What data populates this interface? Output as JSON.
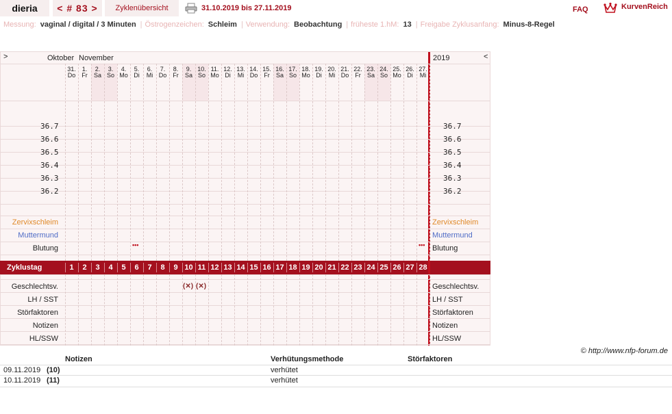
{
  "header": {
    "user": "dieria",
    "cycle": "< # 83 >",
    "overview_tab": "Zyklenübersicht",
    "date_range": "31.10.2019 bis 27.11.2019",
    "faq": "FAQ",
    "logo_text": "KurvenReich"
  },
  "settings": [
    {
      "label": "Messung:",
      "value": "vaginal / digital / 3 Minuten"
    },
    {
      "label": "Östrogenzeichen:",
      "value": "Schleim"
    },
    {
      "label": "Verwendung:",
      "value": "Beobachtung"
    },
    {
      "label": "früheste 1.hM:",
      "value": "13"
    },
    {
      "label": "Freigabe Zyklusanfang:",
      "value": "Minus-8-Regel"
    }
  ],
  "chart": {
    "nav_prev": ">",
    "nav_next": "<",
    "month1": "Oktober",
    "month2": "November",
    "year": "2019",
    "days": [
      {
        "d": "31.",
        "w": "Do",
        "we": false
      },
      {
        "d": "1.",
        "w": "Fr",
        "we": false
      },
      {
        "d": "2.",
        "w": "Sa",
        "we": true
      },
      {
        "d": "3.",
        "w": "So",
        "we": true
      },
      {
        "d": "4.",
        "w": "Mo",
        "we": false
      },
      {
        "d": "5.",
        "w": "Di",
        "we": false
      },
      {
        "d": "6.",
        "w": "Mi",
        "we": false
      },
      {
        "d": "7.",
        "w": "Do",
        "we": false
      },
      {
        "d": "8.",
        "w": "Fr",
        "we": false
      },
      {
        "d": "9.",
        "w": "Sa",
        "we": true
      },
      {
        "d": "10.",
        "w": "So",
        "we": true
      },
      {
        "d": "11.",
        "w": "Mo",
        "we": false
      },
      {
        "d": "12.",
        "w": "Di",
        "we": false
      },
      {
        "d": "13.",
        "w": "Mi",
        "we": false
      },
      {
        "d": "14.",
        "w": "Do",
        "we": false
      },
      {
        "d": "15.",
        "w": "Fr",
        "we": false
      },
      {
        "d": "16.",
        "w": "Sa",
        "we": true
      },
      {
        "d": "17.",
        "w": "So",
        "we": true
      },
      {
        "d": "18.",
        "w": "Mo",
        "we": false
      },
      {
        "d": "19.",
        "w": "Di",
        "we": false
      },
      {
        "d": "20.",
        "w": "Mi",
        "we": false
      },
      {
        "d": "21.",
        "w": "Do",
        "we": false
      },
      {
        "d": "22.",
        "w": "Fr",
        "we": false
      },
      {
        "d": "23.",
        "w": "Sa",
        "we": true
      },
      {
        "d": "24.",
        "w": "So",
        "we": true
      },
      {
        "d": "25.",
        "w": "Mo",
        "we": false
      },
      {
        "d": "26.",
        "w": "Di",
        "we": false
      },
      {
        "d": "27.",
        "w": "Mi",
        "we": false
      }
    ],
    "temps": [
      "36.7",
      "36.6",
      "36.5",
      "36.4",
      "36.3",
      "36.2"
    ],
    "row_labels": {
      "zervix": "Zervixschleim",
      "muttermund": "Muttermund",
      "blutung": "Blutung",
      "zyklustag": "Zyklustag",
      "gv": "Geschlechtsv.",
      "lh": "LH / SST",
      "stoer": "Störfaktoren",
      "notizen": "Notizen",
      "hl": "HL/SSW"
    },
    "cycle_days": [
      1,
      2,
      3,
      4,
      5,
      6,
      7,
      8,
      9,
      10,
      11,
      12,
      13,
      14,
      15,
      16,
      17,
      18,
      19,
      20,
      21,
      22,
      23,
      24,
      25,
      26,
      27,
      28
    ],
    "bleeding_days": [
      6,
      28
    ],
    "bleeding_mark": "•••",
    "intercourse_days": [
      10,
      11
    ],
    "intercourse_mark": "(✕)"
  },
  "footer": {
    "copyright": "© http://www.nfp-forum.de",
    "columns": [
      "Notizen",
      "Verhütungsmethode",
      "Störfaktoren"
    ],
    "rows": [
      {
        "date": "09.11.2019",
        "day": "(10)",
        "method": "verhütet"
      },
      {
        "date": "10.11.2019",
        "day": "(11)",
        "method": "verhütet"
      }
    ]
  },
  "colors": {
    "accent": "#a4101e",
    "zervix": "#e08a2a",
    "muttermund": "#4f6cc6"
  }
}
